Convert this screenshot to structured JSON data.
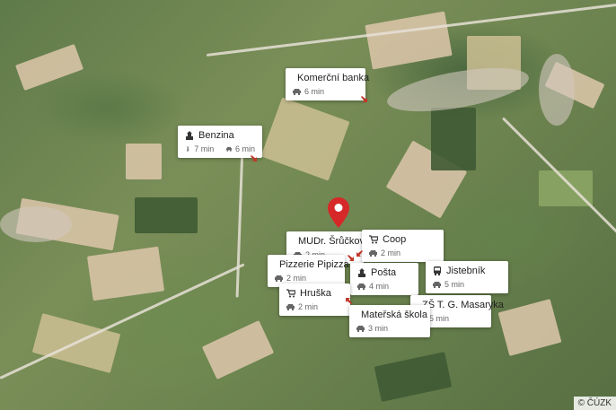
{
  "map": {
    "attribution": "© ČÚZK",
    "pin_icon": "map-pin-icon"
  },
  "places": [
    {
      "name": "Komerční banka",
      "icon": "bank-icon",
      "times": [
        "6 min"
      ]
    },
    {
      "name": "Benzina",
      "icon": "fuel-station-icon",
      "times": [
        "7 min",
        "6 min"
      ]
    },
    {
      "name": "MUDr. Šrůčková ...",
      "icon": "doctor-icon",
      "times": [
        "2 min"
      ]
    },
    {
      "name": "Coop",
      "icon": "shop-cart-icon",
      "times": [
        "2 min"
      ]
    },
    {
      "name": "Pizzerie Pipizza",
      "icon": "restaurant-icon",
      "times": [
        "2 min"
      ]
    },
    {
      "name": "Pošta",
      "icon": "post-office-icon",
      "times": [
        "4 min"
      ]
    },
    {
      "name": "Jistebník",
      "icon": "bus-icon",
      "times": [
        "5 min"
      ]
    },
    {
      "name": "Hruška",
      "icon": "shop-cart-icon",
      "times": [
        "2 min"
      ]
    },
    {
      "name": "ZŠ T. G. Masaryka",
      "icon": "school-icon",
      "times": [
        "5 min"
      ]
    },
    {
      "name": "Mateřská škola",
      "icon": "school-icon",
      "times": [
        "3 min"
      ]
    }
  ]
}
